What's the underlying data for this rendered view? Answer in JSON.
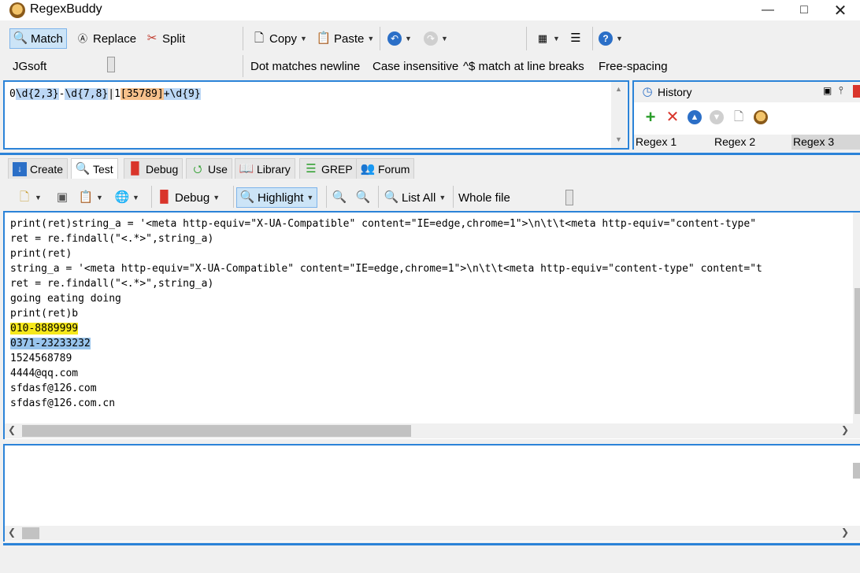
{
  "window": {
    "title": "RegexBuddy"
  },
  "toolbar": {
    "match": "Match",
    "replace": "Replace",
    "split": "Split",
    "copy": "Copy",
    "paste": "Paste"
  },
  "options": {
    "flavor": "JGsoft",
    "dot_newline": "Dot matches newline",
    "case_insensitive": "Case insensitive",
    "line_breaks": "^$ match at line breaks",
    "free_spacing": "Free-spacing"
  },
  "regex": {
    "parts": [
      "0",
      "\\d{2,3}",
      "-",
      "\\d{7,8}",
      "|",
      "1",
      "[35789]",
      "+\\d{9}"
    ]
  },
  "history": {
    "title": "History",
    "tabs": [
      "Regex 1",
      "Regex 2",
      "Regex 3"
    ]
  },
  "tabs": [
    "Create",
    "Test",
    "Debug",
    "Use",
    "Library",
    "GREP",
    "Forum"
  ],
  "test_toolbar": {
    "debug": "Debug",
    "highlight": "Highlight",
    "list_all": "List All",
    "scope": "Whole file"
  },
  "subject": {
    "lines": [
      "print(ret)string_a = '<meta http-equiv=\"X-UA-Compatible\" content=\"IE=edge,chrome=1\">\\n\\t\\t<meta http-equiv=\"content-type\"",
      "ret = re.findall(\"<.*>\",string_a)",
      "print(ret)",
      "string_a = '<meta http-equiv=\"X-UA-Compatible\" content=\"IE=edge,chrome=1\">\\n\\t\\t<meta http-equiv=\"content-type\" content=\"t",
      "ret = re.findall(\"<.*>\",string_a)",
      "going eating doing",
      "print(ret)b",
      "010-8889999",
      "0371-23233232",
      "1524568789",
      "4444@qq.com",
      "sfdasf@126.com",
      "sfdasf@126.com.cn"
    ]
  },
  "colors": {
    "accent": "#2b83d8",
    "match1": "#f6e81c",
    "match2": "#98c4ec",
    "regex_token": "#bcd7f5",
    "regex_class": "#f6c08b"
  }
}
